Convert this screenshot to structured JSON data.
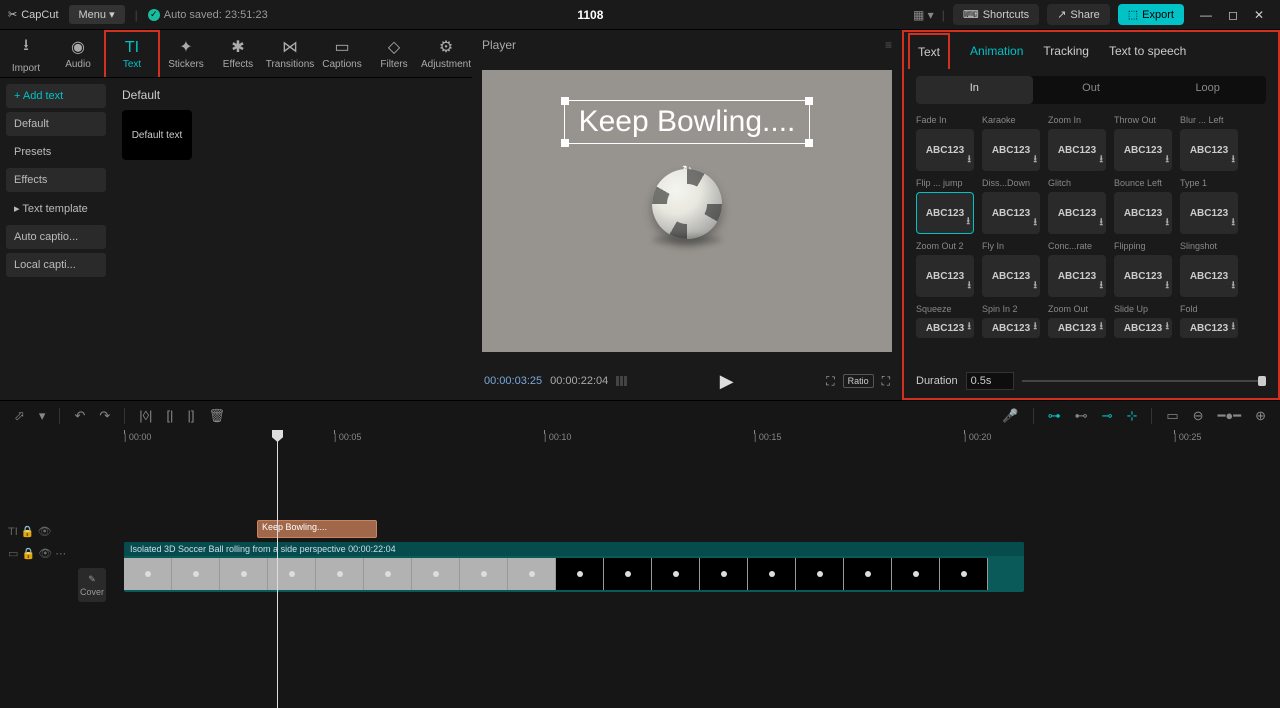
{
  "titlebar": {
    "app": "CapCut",
    "menu": "Menu ▾",
    "autosave": "Auto saved: 23:51:23",
    "project": "1108",
    "shortcuts": "Shortcuts",
    "share": "Share",
    "export": "Export"
  },
  "mediaTabs": [
    "Import",
    "Audio",
    "Text",
    "Stickers",
    "Effects",
    "Transitions",
    "Captions",
    "Filters",
    "Adjustment"
  ],
  "mediaTabIcons": [
    "⭳",
    "◉",
    "TI",
    "✦",
    "✱",
    "⋈",
    "▭",
    "◇",
    "⚙"
  ],
  "textSidebar": {
    "add": "+ Add text",
    "items": [
      "Default",
      "Presets",
      "Effects",
      "▸ Text template",
      "Auto captio...",
      "Local capti..."
    ]
  },
  "textContent": {
    "heading": "Default",
    "card": "Default text"
  },
  "preview": {
    "title": "Player",
    "textbox": "Keep Bowling....",
    "time_current": "00:00:03:25",
    "time_total": "00:00:22:04",
    "ratio": "Ratio"
  },
  "rightTabs": [
    "Text",
    "Animation",
    "Tracking",
    "Text to speech"
  ],
  "animSub": [
    "In",
    "Out",
    "Loop"
  ],
  "animations": [
    {
      "name": "Fade In"
    },
    {
      "name": "Karaoke"
    },
    {
      "name": "Zoom In"
    },
    {
      "name": "Throw Out"
    },
    {
      "name": "Blur ... Left"
    },
    {
      "name": "Flip ... jump",
      "sel": true
    },
    {
      "name": "Diss...Down"
    },
    {
      "name": "Glitch"
    },
    {
      "name": "Bounce Left"
    },
    {
      "name": "Type 1"
    },
    {
      "name": "Zoom Out 2"
    },
    {
      "name": "Fly In"
    },
    {
      "name": "Conc...rate"
    },
    {
      "name": "Flipping"
    },
    {
      "name": "Slingshot"
    },
    {
      "name": "Squeeze"
    },
    {
      "name": "Spin In 2"
    },
    {
      "name": "Zoom Out"
    },
    {
      "name": "Slide Up"
    },
    {
      "name": "Fold"
    }
  ],
  "duration": {
    "label": "Duration",
    "value": "0.5s"
  },
  "timeline": {
    "ticks": [
      "00:00",
      "00:05",
      "00:10",
      "00:15",
      "00:20",
      "00:25"
    ],
    "text_clip": "Keep Bowling....",
    "video_label": "Isolated 3D Soccer Ball rolling from a side perspective   00:00:22:04",
    "cover": "Cover"
  }
}
